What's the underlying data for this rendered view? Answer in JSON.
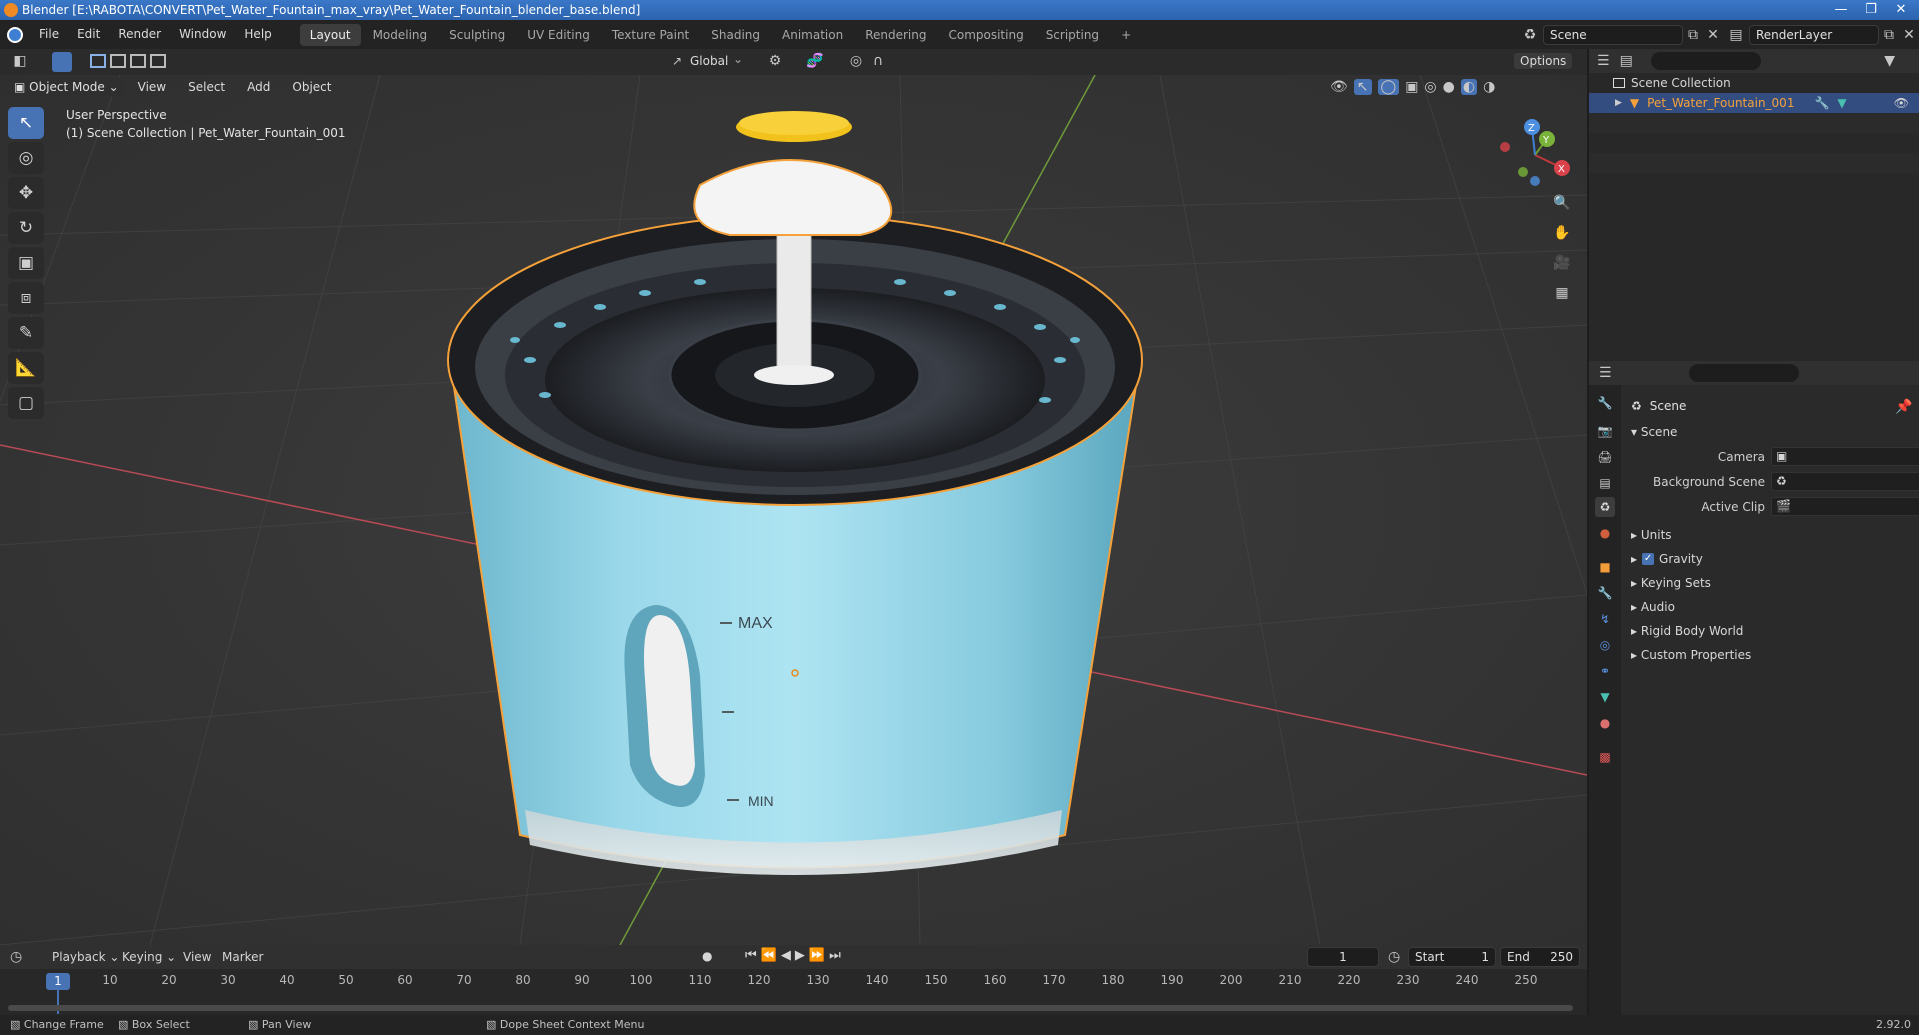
{
  "window": {
    "title": "Blender [E:\\RABOTA\\CONVERT\\Pet_Water_Fountain_max_vray\\Pet_Water_Fountain_blender_base.blend]"
  },
  "menu": [
    "File",
    "Edit",
    "Render",
    "Window",
    "Help"
  ],
  "workspaces": [
    "Layout",
    "Modeling",
    "Sculpting",
    "UV Editing",
    "Texture Paint",
    "Shading",
    "Animation",
    "Rendering",
    "Compositing",
    "Scripting"
  ],
  "active_workspace": "Layout",
  "scene_field": "Scene",
  "renderlayer_field": "RenderLayer",
  "viewport_header": {
    "transform_orientation": "Global",
    "options": "Options",
    "mode": "Object Mode",
    "menus": [
      "View",
      "Select",
      "Add",
      "Object"
    ]
  },
  "viewport": {
    "perspective": "User Perspective",
    "collection_info": "(1) Scene Collection | Pet_Water_Fountain_001",
    "label_max": "MAX",
    "label_min": "MIN",
    "gizmo": {
      "x": "X",
      "y": "Y",
      "z": "Z"
    }
  },
  "outliner": {
    "root": "Scene Collection",
    "item": "Pet_Water_Fountain_001"
  },
  "properties": {
    "context": "Scene",
    "panel": "Scene",
    "camera_label": "Camera",
    "background_label": "Background Scene",
    "clip_label": "Active Clip",
    "subpanels": [
      "Units",
      "Gravity",
      "Keying Sets",
      "Audio",
      "Rigid Body World",
      "Custom Properties"
    ],
    "gravity_checked": true
  },
  "timeline": {
    "menus": [
      "Playback",
      "Keying",
      "View",
      "Marker"
    ],
    "current_frame": "1",
    "start_label": "Start",
    "start": "1",
    "end_label": "End",
    "end": "250",
    "ticks": [
      "1",
      "10",
      "20",
      "30",
      "40",
      "50",
      "60",
      "70",
      "80",
      "90",
      "100",
      "110",
      "120",
      "130",
      "140",
      "150",
      "160",
      "170",
      "180",
      "190",
      "200",
      "210",
      "220",
      "230",
      "240",
      "250"
    ]
  },
  "status": {
    "change_frame": "Change Frame",
    "box_select": "Box Select",
    "pan_view": "Pan View",
    "context_menu": "Dope Sheet Context Menu",
    "version": "2.92.0"
  },
  "colors": {
    "accent": "#4772b3",
    "selection_outline": "#f5a13a",
    "fountain_body": "#8fd0e4"
  }
}
